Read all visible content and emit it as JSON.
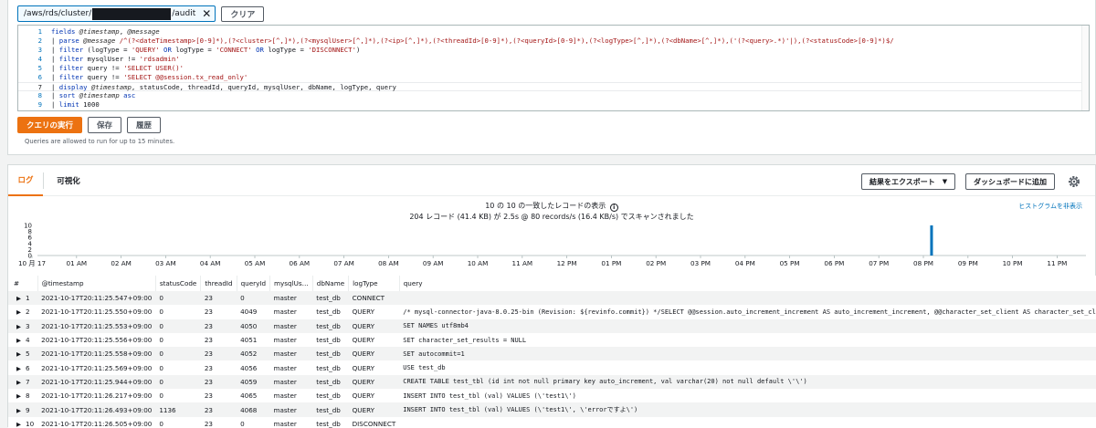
{
  "log_group": {
    "prefix": "/aws/rds/cluster/",
    "suffix": "/audit",
    "clear_label": "クリア"
  },
  "query_lines": [
    {
      "num": "1",
      "html": "<span class=\"kw\">fields</span> <span class=\"fld\">@timestamp</span>, <span class=\"fld\">@message</span>"
    },
    {
      "num": "2",
      "html": "| <span class=\"kw\">parse</span> <span class=\"fld\">@message</span> <span class=\"str\">/^(?&lt;dateTimestamp&gt;[0-9]*),(?&lt;cluster&gt;[^,]*),(?&lt;mysqlUser&gt;[^,]*),(?&lt;ip&gt;[^,]*),(?&lt;threadId&gt;[0-9]*),(?&lt;queryId&gt;[0-9]*),(?&lt;logType&gt;[^,]*),(?&lt;dbName&gt;[^,]*),('(?&lt;query&gt;.*)'|),(?&lt;statusCode&gt;[0-9]*)$/</span>"
    },
    {
      "num": "3",
      "html": "| <span class=\"kw\">filter</span> (logType = <span class=\"str\">'QUERY'</span> <span class=\"kw\">OR</span> logType = <span class=\"str\">'CONNECT'</span> <span class=\"kw\">OR</span> logType = <span class=\"str\">'DISCONNECT'</span>)"
    },
    {
      "num": "4",
      "html": "| <span class=\"kw\">filter</span> mysqlUser != <span class=\"str\">'rdsadmin'</span>"
    },
    {
      "num": "5",
      "html": "| <span class=\"kw\">filter</span> query != <span class=\"str\">'SELECT USER()'</span>"
    },
    {
      "num": "6",
      "html": "| <span class=\"kw\">filter</span> query != <span class=\"str\">'SELECT @@session.tx_read_only'</span>"
    },
    {
      "num": "7",
      "html": "| <span class=\"kw\">display</span> <span class=\"fld\">@timestamp</span>, statusCode, threadId, queryId, mysqlUser, dbName, logType, query"
    },
    {
      "num": "8",
      "html": "| <span class=\"kw\">sort</span> <span class=\"fld\">@timestamp</span> <span class=\"kw\">asc</span>"
    },
    {
      "num": "9",
      "html": "| <span class=\"kw\">limit</span> 1000"
    }
  ],
  "actions": {
    "run": "クエリの実行",
    "save": "保存",
    "history": "履歴",
    "hint": "Queries are allowed to run for up to 15 minutes."
  },
  "tabs": {
    "logs": "ログ",
    "visualize": "可視化"
  },
  "toolbar": {
    "export": "結果をエクスポート",
    "export_caret": "▼",
    "dashboard": "ダッシュボードに追加"
  },
  "summary": {
    "line1": "10 の 10 の一致したレコードの表示",
    "line2": "204 レコード (41.4 KB) が 2.5s @ 80 records/s (16.4 KB/s) でスキャンされました",
    "hide_histogram": "ヒストグラムを非表示"
  },
  "histogram": {
    "y_ticks": [
      "10",
      "8",
      "6",
      "4",
      "2",
      "0"
    ],
    "x_ticks": [
      "10 月 17",
      "01 AM",
      "02 AM",
      "03 AM",
      "04 AM",
      "05 AM",
      "06 AM",
      "07 AM",
      "08 AM",
      "09 AM",
      "10 AM",
      "11 AM",
      "12 PM",
      "01 PM",
      "02 PM",
      "03 PM",
      "04 PM",
      "05 PM",
      "06 PM",
      "07 PM",
      "08 PM",
      "09 PM",
      "10 PM",
      "11 PM"
    ],
    "bar_color": "#0073bb"
  },
  "chart_data": {
    "type": "bar",
    "x_range": [
      "10 月 17",
      "11 PM"
    ],
    "ylim": [
      0,
      10
    ],
    "series": [
      {
        "time": "08:11 PM",
        "count": 10
      }
    ]
  },
  "table": {
    "headers": [
      "#",
      "@timestamp",
      "statusCode",
      "threadId",
      "queryId",
      "mysqlUs…",
      "dbName",
      "logType",
      "query"
    ],
    "rows": [
      [
        "1",
        "2021-10-17T20:11:25.547+09:00",
        "0",
        "23",
        "0",
        "master",
        "test_db",
        "CONNECT",
        ""
      ],
      [
        "2",
        "2021-10-17T20:11:25.550+09:00",
        "0",
        "23",
        "4049",
        "master",
        "test_db",
        "QUERY",
        "/* mysql-connector-java-8.0.25-bin (Revision: ${revinfo.commit}) */SELECT @@session.auto_increment_increment AS auto_increment_increment, @@character_set_client AS character_set_cli"
      ],
      [
        "3",
        "2021-10-17T20:11:25.553+09:00",
        "0",
        "23",
        "4050",
        "master",
        "test_db",
        "QUERY",
        "SET NAMES utf8mb4"
      ],
      [
        "4",
        "2021-10-17T20:11:25.556+09:00",
        "0",
        "23",
        "4051",
        "master",
        "test_db",
        "QUERY",
        "SET character_set_results = NULL"
      ],
      [
        "5",
        "2021-10-17T20:11:25.558+09:00",
        "0",
        "23",
        "4052",
        "master",
        "test_db",
        "QUERY",
        "SET autocommit=1"
      ],
      [
        "6",
        "2021-10-17T20:11:25.569+09:00",
        "0",
        "23",
        "4056",
        "master",
        "test_db",
        "QUERY",
        "USE test_db"
      ],
      [
        "7",
        "2021-10-17T20:11:25.944+09:00",
        "0",
        "23",
        "4059",
        "master",
        "test_db",
        "QUERY",
        "CREATE TABLE test_tbl (id int not null primary key auto_increment, val varchar(20) not null default \\'\\')"
      ],
      [
        "8",
        "2021-10-17T20:11:26.217+09:00",
        "0",
        "23",
        "4065",
        "master",
        "test_db",
        "QUERY",
        "INSERT INTO test_tbl (val) VALUES (\\'test1\\')"
      ],
      [
        "9",
        "2021-10-17T20:11:26.493+09:00",
        "1136",
        "23",
        "4068",
        "master",
        "test_db",
        "QUERY",
        "INSERT INTO test_tbl (val) VALUES (\\'test1\\', \\'errorですよ\\')"
      ],
      [
        "10",
        "2021-10-17T20:11:26.505+09:00",
        "0",
        "23",
        "0",
        "master",
        "test_db",
        "DISCONNECT",
        ""
      ]
    ]
  }
}
